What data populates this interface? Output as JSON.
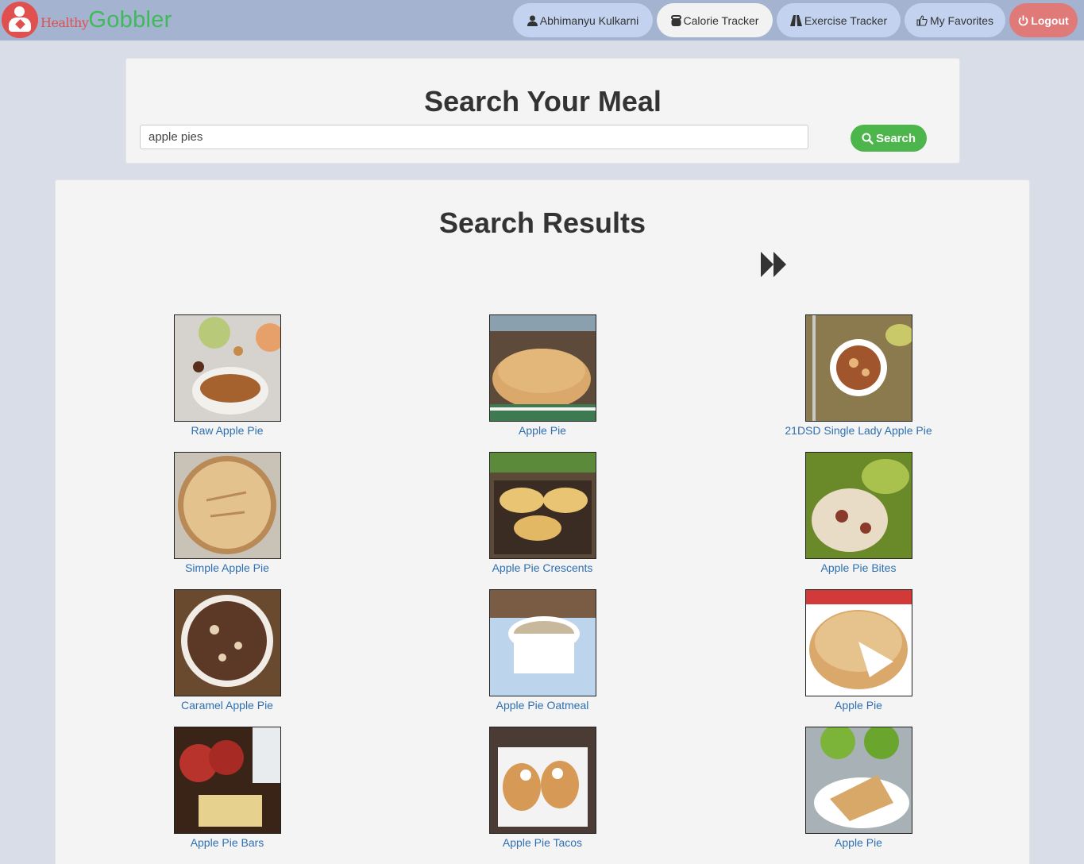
{
  "brand": {
    "healthy": "Healthy",
    "gobbler": "Gobbler"
  },
  "nav": {
    "user": {
      "label": "Abhimanyu Kulkarni",
      "icon": "user-icon"
    },
    "calorie": {
      "label": "Calorie Tracker",
      "icon": "kettlebell-icon"
    },
    "exercise": {
      "label": "Exercise Tracker",
      "icon": "road-icon"
    },
    "favorites": {
      "label": "My Favorites",
      "icon": "thumbs-up-icon"
    },
    "logout": {
      "label": "Logout",
      "icon": "power-icon"
    }
  },
  "search": {
    "title": "Search Your Meal",
    "value": "apple pies",
    "button_label": "Search"
  },
  "results": {
    "title": "Search Results",
    "next_icon": "fast-forward-icon",
    "items": [
      {
        "label": "Raw Apple Pie"
      },
      {
        "label": "Apple Pie"
      },
      {
        "label": "21DSD Single Lady Apple Pie"
      },
      {
        "label": "Simple Apple Pie"
      },
      {
        "label": "Apple Pie Crescents"
      },
      {
        "label": "Apple Pie Bites"
      },
      {
        "label": "Caramel Apple Pie"
      },
      {
        "label": "Apple Pie Oatmeal"
      },
      {
        "label": "Apple Pie"
      },
      {
        "label": "Apple Pie Bars"
      },
      {
        "label": "Apple Pie Tacos"
      },
      {
        "label": "Apple Pie"
      }
    ]
  },
  "colors": {
    "navbar": "#a3b3d0",
    "nav_button": "#c3d3ef",
    "logout": "#e07a79",
    "search_button": "#4cb54b",
    "link": "#2f6fb0",
    "brand_red": "#e0504f",
    "brand_green": "#3fba5a"
  }
}
